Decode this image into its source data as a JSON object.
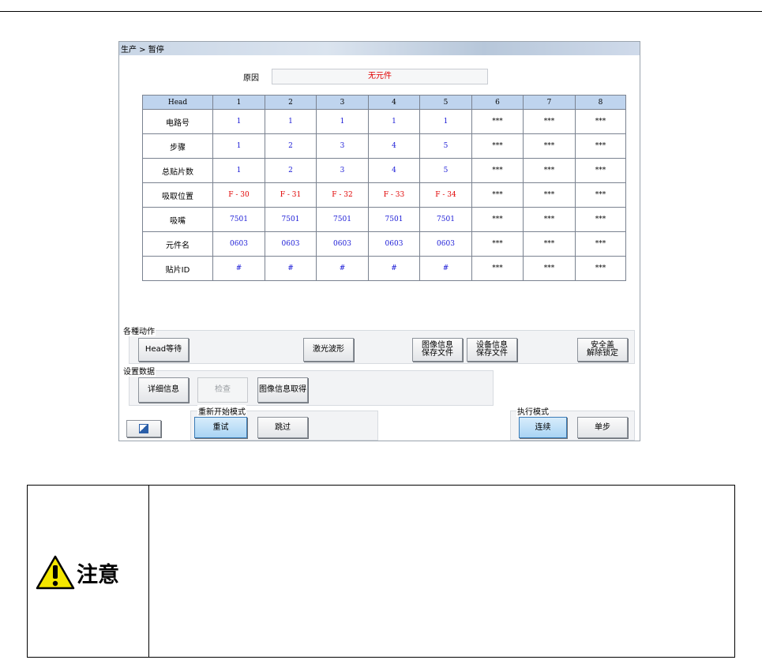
{
  "window": {
    "breadcrumb": "生产 > 暂停"
  },
  "reason": {
    "label": "原因",
    "value": "无元件"
  },
  "table": {
    "columns": [
      "Head",
      "1",
      "2",
      "3",
      "4",
      "5",
      "6",
      "7",
      "8"
    ],
    "rows": [
      {
        "label": "电路号",
        "cells": [
          "1",
          "1",
          "1",
          "1",
          "1",
          "***",
          "***",
          "***"
        ]
      },
      {
        "label": "步骤",
        "cells": [
          "1",
          "2",
          "3",
          "4",
          "5",
          "***",
          "***",
          "***"
        ]
      },
      {
        "label": "总贴片数",
        "cells": [
          "1",
          "2",
          "3",
          "4",
          "5",
          "***",
          "***",
          "***"
        ]
      },
      {
        "label": "吸取位置",
        "cells": [
          "F - 30",
          "F - 31",
          "F - 32",
          "F - 33",
          "F - 34",
          "***",
          "***",
          "***"
        ]
      },
      {
        "label": "吸嘴",
        "cells": [
          "7501",
          "7501",
          "7501",
          "7501",
          "7501",
          "***",
          "***",
          "***"
        ]
      },
      {
        "label": "元件名",
        "cells": [
          "0603",
          "0603",
          "0603",
          "0603",
          "0603",
          "***",
          "***",
          "***"
        ]
      },
      {
        "label": "贴片ID",
        "cells": [
          "#",
          "#",
          "#",
          "#",
          "#",
          "***",
          "***",
          "***"
        ]
      }
    ]
  },
  "actions": {
    "group_label": "各種动作",
    "head_wait": "Head等待",
    "laser": "激光波形",
    "image_info_l1": "图像信息",
    "image_info_l2": "保存文件",
    "device_info_l1": "设备信息",
    "device_info_l2": "保存文件",
    "safety_l1": "安全盖",
    "safety_l2": "解除锁定"
  },
  "settings": {
    "group_label": "设置数据",
    "detail": "详细信息",
    "check": "检查",
    "image_get": "图像信息取得"
  },
  "restart": {
    "group_label": "重新开始模式",
    "retry": "重试",
    "skip": "跳过"
  },
  "exec": {
    "group_label": "执行模式",
    "continuous": "连续",
    "single": "单步"
  },
  "notice": {
    "label": "注意"
  },
  "colors": {
    "header_bg": "#bfd4ee",
    "value_blue": "#1a1ad6",
    "value_red": "#e00000",
    "accent_selected": "#a9d4f4"
  }
}
